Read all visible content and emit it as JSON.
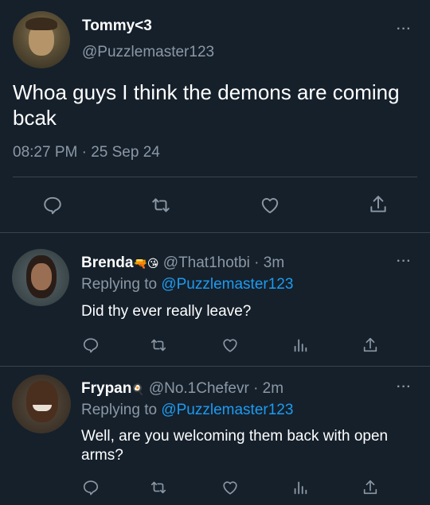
{
  "main_tweet": {
    "display_name": "Tommy<3",
    "handle": "@Puzzlemaster123",
    "text": "Whoa guys I think the demons are coming bcak",
    "time": "08:27 PM",
    "separator": "·",
    "date": "25 Sep 24",
    "more": "···"
  },
  "replies": [
    {
      "display_name": "Brenda",
      "emoji": "🔫😘",
      "handle": "@That1hotbi",
      "separator": "·",
      "time": "3m",
      "replying_prefix": "Replying to",
      "replying_to": "@Puzzlemaster123",
      "text": "Did thy ever really leave?",
      "more": "···"
    },
    {
      "display_name": "Frypan",
      "emoji": "🍳",
      "handle": "@No.1Chefevr",
      "separator": "·",
      "time": "2m",
      "replying_prefix": "Replying to",
      "replying_to": "@Puzzlemaster123",
      "text": "Well, are you welcoming them back with open arms?",
      "more": "···"
    }
  ],
  "icons": {
    "reply": "reply-icon",
    "retweet": "retweet-icon",
    "like": "heart-icon",
    "analytics": "analytics-icon",
    "share": "share-icon"
  },
  "colors": {
    "background": "#15202b",
    "text": "#ffffff",
    "muted": "#8b98a5",
    "link": "#1d9bf0",
    "divider": "#38444d"
  }
}
